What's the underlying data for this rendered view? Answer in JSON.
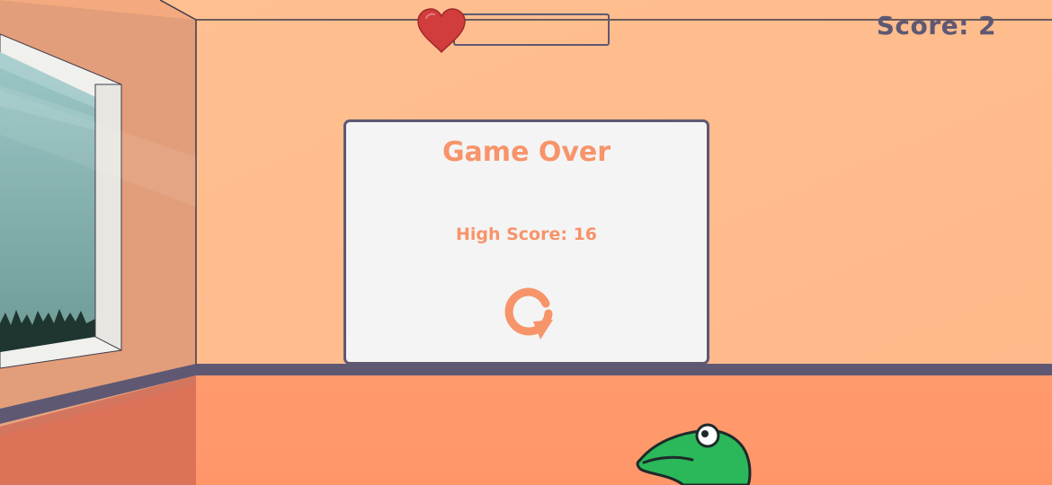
{
  "hud": {
    "score_text": "Score: 2",
    "health_fraction": 0,
    "heart_icon": "heart-icon",
    "heart_color": "#D13C3C"
  },
  "dialog": {
    "title": "Game Over",
    "high_score_text": "High Score: 16",
    "restart_icon": "restart-icon"
  },
  "colors": {
    "wall": "#FFBF90",
    "floor": "#FF9A6C",
    "baseboard": "#5E5873",
    "text_dark": "#5E5873",
    "accent_orange": "#F7946A",
    "panel_bg": "#F4F4F4",
    "player_green": "#2BB85A"
  }
}
